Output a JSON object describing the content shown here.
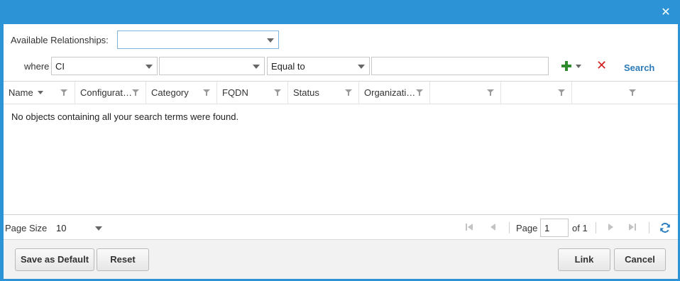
{
  "window": {
    "close_glyph": "✕"
  },
  "filter": {
    "relationships_label": "Available Relationships:",
    "relationships_value": "",
    "where_label": "where",
    "field_value": "CI",
    "attribute_value": "",
    "operator_value": "Equal to",
    "search_value": "",
    "search_link": "Search"
  },
  "grid": {
    "columns": [
      {
        "label": "Name"
      },
      {
        "label": "Configuratio..."
      },
      {
        "label": "Category"
      },
      {
        "label": "FQDN"
      },
      {
        "label": "Status"
      },
      {
        "label": "Organizatio..."
      },
      {
        "label": ""
      },
      {
        "label": ""
      },
      {
        "label": ""
      }
    ],
    "empty_message": "No objects containing all your search terms were found."
  },
  "pager": {
    "page_size_label": "Page Size",
    "page_size_value": "10",
    "page_label": "Page",
    "page_value": "1",
    "of_label": "of 1"
  },
  "footer": {
    "save_default": "Save as Default",
    "reset": "Reset",
    "link": "Link",
    "cancel": "Cancel"
  },
  "colors": {
    "titlebar": "#2b93d6",
    "add": "#2e8b2e",
    "remove": "#d21f1f",
    "link": "#2a7ab8"
  },
  "icons": {
    "close": "close-icon",
    "add": "plus-icon",
    "remove": "x-icon",
    "refresh": "refresh-icon"
  }
}
